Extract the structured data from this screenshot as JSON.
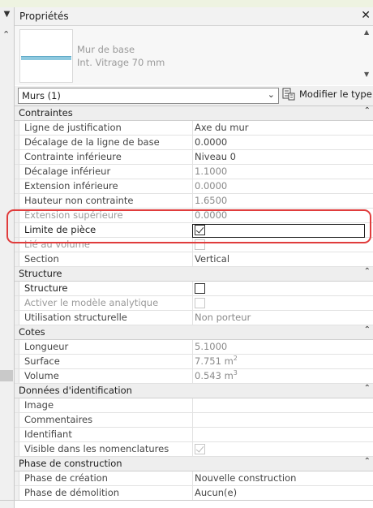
{
  "panel": {
    "title": "Propriétés",
    "close_glyph": "✕"
  },
  "type_selector": {
    "family": "Mur de base",
    "type": "Int. Vitrage 70 mm"
  },
  "instance": {
    "selected": "Murs (1)",
    "edit_type_label": "Modifier le type"
  },
  "groups": {
    "contraintes": {
      "title": "Contraintes",
      "rows": [
        {
          "name": "Ligne de justification",
          "value": "Axe du mur"
        },
        {
          "name": "Décalage de la ligne de base",
          "value": "0.0000"
        },
        {
          "name": "Contrainte inférieure",
          "value": "Niveau 0"
        },
        {
          "name": "Décalage inférieur",
          "value": "1.1000"
        },
        {
          "name": "Extension inférieure",
          "value": "0.0000"
        },
        {
          "name": "Hauteur non contrainte",
          "value": "1.6500"
        },
        {
          "name": "Extension supérieure",
          "value": "0.0000"
        },
        {
          "name": "Limite de pièce",
          "checked": true
        },
        {
          "name": "Lié au volume",
          "checked": false
        },
        {
          "name": "Section",
          "value": "Vertical"
        }
      ]
    },
    "structure": {
      "title": "Structure",
      "rows": [
        {
          "name": "Structure",
          "checked": false
        },
        {
          "name": "Activer le modèle analytique",
          "checked": false
        },
        {
          "name": "Utilisation structurelle",
          "value": "Non porteur"
        }
      ]
    },
    "cotes": {
      "title": "Cotes",
      "rows": [
        {
          "name": "Longueur",
          "value": "5.1000"
        },
        {
          "name": "Surface",
          "value": "7.751 m",
          "unit_exp": "2"
        },
        {
          "name": "Volume",
          "value": "0.543 m",
          "unit_exp": "3"
        }
      ]
    },
    "identification": {
      "title": "Données d'identification",
      "rows": [
        {
          "name": "Image",
          "value": ""
        },
        {
          "name": "Commentaires",
          "value": ""
        },
        {
          "name": "Identifiant",
          "value": ""
        },
        {
          "name": "Visible dans les nomenclatures",
          "checked": true
        }
      ]
    },
    "phase": {
      "title": "Phase de construction",
      "rows": [
        {
          "name": "Phase de création",
          "value": "Nouvelle construction"
        },
        {
          "name": "Phase de démolition",
          "value": "Aucun(e)"
        }
      ]
    }
  },
  "icons": {
    "collapse": "⌃",
    "dropdown": "⌄",
    "filter": "▼",
    "scroll_up": "▲",
    "scroll_down": "▼"
  },
  "colors": {
    "highlight": "#e03c3c",
    "wall_preview": "#8ec9df"
  }
}
